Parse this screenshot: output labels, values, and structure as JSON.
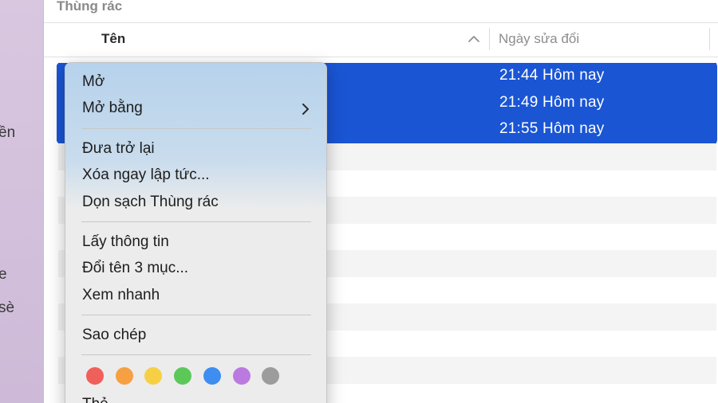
{
  "window": {
    "title": "Thùng rác"
  },
  "sidebar": {
    "fragments": [
      "ền",
      "e",
      "sè"
    ]
  },
  "columns": {
    "name": "Tên",
    "date_modified": "Ngày sửa đổi"
  },
  "rows": [
    {
      "date": "21:44 Hôm nay",
      "selected": true
    },
    {
      "date": "21:49 Hôm nay",
      "selected": true
    },
    {
      "date": "21:55 Hôm nay",
      "selected": true
    }
  ],
  "context_menu": {
    "open": "Mở",
    "open_with": "Mở bằng",
    "put_back": "Đưa trở lại",
    "delete_immediately": "Xóa ngay lập tức...",
    "empty_trash": "Dọn sạch Thùng rác",
    "get_info": "Lấy thông tin",
    "rename": "Đổi tên 3 mục...",
    "quick_look": "Xem nhanh",
    "copy": "Sao chép",
    "cut_off_item": "Thẻ...",
    "tags": [
      {
        "name": "red",
        "color": "#f0605a"
      },
      {
        "name": "orange",
        "color": "#f6a043"
      },
      {
        "name": "yellow",
        "color": "#f6cf45"
      },
      {
        "name": "green",
        "color": "#5dc85a"
      },
      {
        "name": "blue",
        "color": "#3d8ef0"
      },
      {
        "name": "purple",
        "color": "#bb7ae0"
      },
      {
        "name": "gray",
        "color": "#9c9c9c"
      }
    ]
  },
  "colors": {
    "selection": "#1a55d4",
    "menu_top": "#b6d2ec",
    "sidebar": "#d9c7e0"
  }
}
